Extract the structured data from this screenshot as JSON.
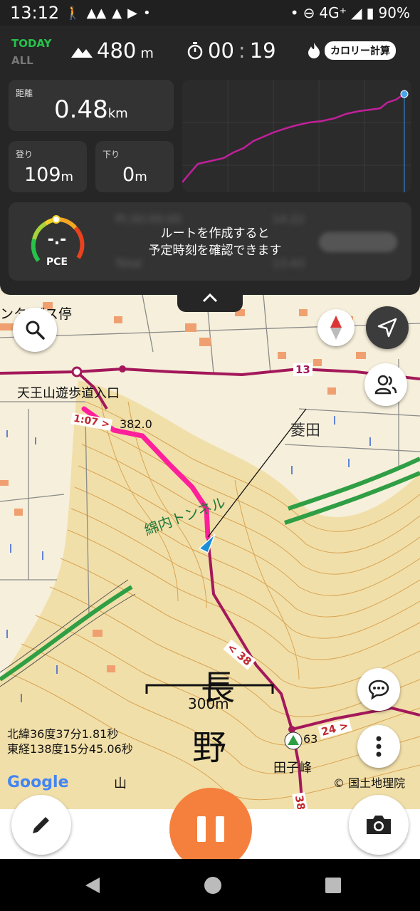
{
  "status_bar": {
    "time": "13:12",
    "network": "4G⁺",
    "battery": "90%"
  },
  "header": {
    "today": "TODAY",
    "all": "ALL",
    "altitude": "480",
    "altitude_unit": "m",
    "timer_hh": "00",
    "timer_mm": "19",
    "calorie_button": "カロリー計算"
  },
  "stats": {
    "distance": {
      "label": "距離",
      "value": "0.48",
      "unit": "km"
    },
    "ascent": {
      "label": "登り",
      "value": "109",
      "unit": "m"
    },
    "descent": {
      "label": "下り",
      "value": "0",
      "unit": "m"
    }
  },
  "pce": {
    "label": "PCE",
    "value": "-.-",
    "message_line1": "ルートを作成すると",
    "message_line2": "予定時刻を確認できます"
  },
  "map": {
    "labels": {
      "trailhead": "天王山遊歩道入口",
      "bus_stop": "ンタ バス停",
      "nagano_1": "長",
      "nagano_2": "野",
      "hishida": "菱田",
      "tunnel": "綿内トンネル",
      "peak": "田子峰",
      "peak_elev": "63",
      "yama": "山",
      "route_13": "13",
      "route_38a": "< 38",
      "route_24": "24 >",
      "route_38b": "38",
      "route_time": "1:07 >",
      "elev_point": "382.0"
    },
    "scale": "300m",
    "lat": "北緯36度37分1.81秒",
    "lon": "東経138度15分45.06秒",
    "google": "Google",
    "attribution": "© 国土地理院"
  },
  "colors": {
    "accent": "#f5803e",
    "track": "#ff1f9a",
    "route": "#a3185a",
    "green": "#27c24a"
  }
}
